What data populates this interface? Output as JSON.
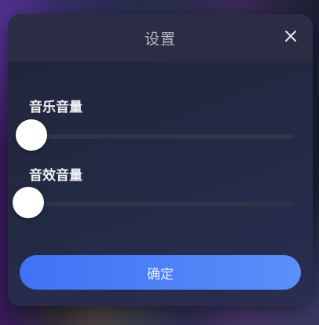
{
  "dialog": {
    "title": "设置",
    "close_icon": "close-icon"
  },
  "music_volume": {
    "label": "音乐音量",
    "value": 0
  },
  "sfx_volume": {
    "label": "音效音量",
    "value": 0
  },
  "confirm_button": {
    "label": "确定"
  },
  "colors": {
    "accent": "#4a7ef6",
    "panel": "#22253a",
    "header": "#2b2d44",
    "track": "#303449"
  }
}
